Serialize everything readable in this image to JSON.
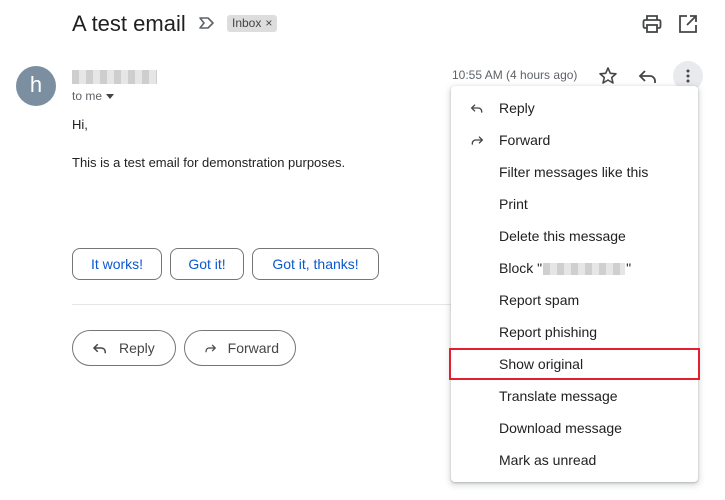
{
  "email": {
    "subject": "A test email",
    "label": "Inbox",
    "label_remove": "×",
    "avatar_letter": "h",
    "recipient": "to me",
    "timestamp": "10:55 AM (4 hours ago)",
    "body": [
      "Hi,",
      "This is a test email for demonstration purposes."
    ]
  },
  "smart_replies": [
    "It works!",
    "Got it!",
    "Got it, thanks!"
  ],
  "actions": {
    "reply": "Reply",
    "forward": "Forward"
  },
  "menu": {
    "items": [
      {
        "label": "Reply",
        "icon": "reply-icon"
      },
      {
        "label": "Forward",
        "icon": "forward-icon"
      },
      {
        "label": "Filter messages like this"
      },
      {
        "label": "Print"
      },
      {
        "label": "Delete this message"
      },
      {
        "label_prefix": "Block \"",
        "label_suffix": "\""
      },
      {
        "label": "Report spam"
      },
      {
        "label": "Report phishing"
      },
      {
        "label": "Show original",
        "highlighted": true
      },
      {
        "label": "Translate message"
      },
      {
        "label": "Download message"
      },
      {
        "label": "Mark as unread"
      }
    ]
  },
  "colors": {
    "highlight_border": "#e0202f",
    "smart_reply_text": "#0b57d0",
    "avatar_bg": "#7b8fa0"
  }
}
